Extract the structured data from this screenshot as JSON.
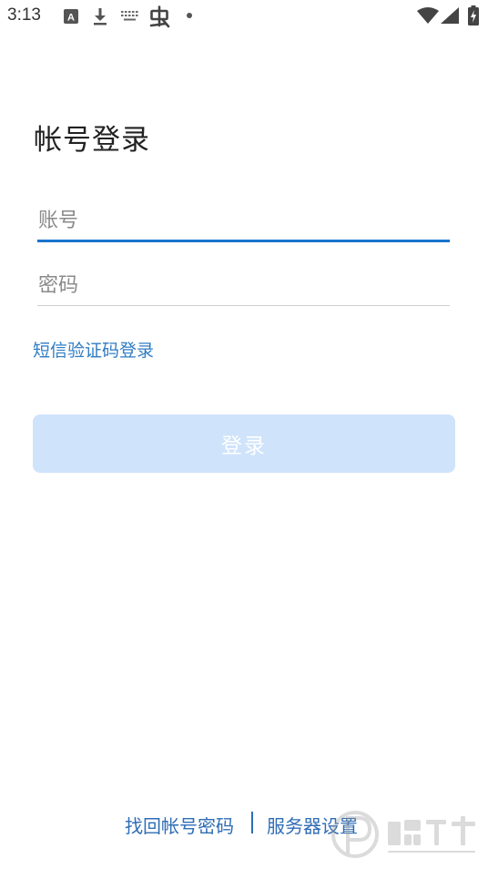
{
  "status_bar": {
    "time": "3:13",
    "icons": [
      "a-badge-icon",
      "download-icon",
      "keyboard-icon",
      "bug-icon",
      "dot-icon",
      "wifi-icon",
      "signal-icon",
      "battery-charging-icon"
    ]
  },
  "title": "帐号登录",
  "account_input": {
    "placeholder": "账号",
    "value": ""
  },
  "password_input": {
    "placeholder": "密码",
    "value": ""
  },
  "sms_login_link": "短信验证码登录",
  "login_button": "登录",
  "footer": {
    "recover_link": "找回帐号密码",
    "server_link": "服务器设置"
  },
  "colors": {
    "accent": "#1874cd",
    "link": "#2f7cc4",
    "button_disabled_bg": "#cfe3fb"
  }
}
